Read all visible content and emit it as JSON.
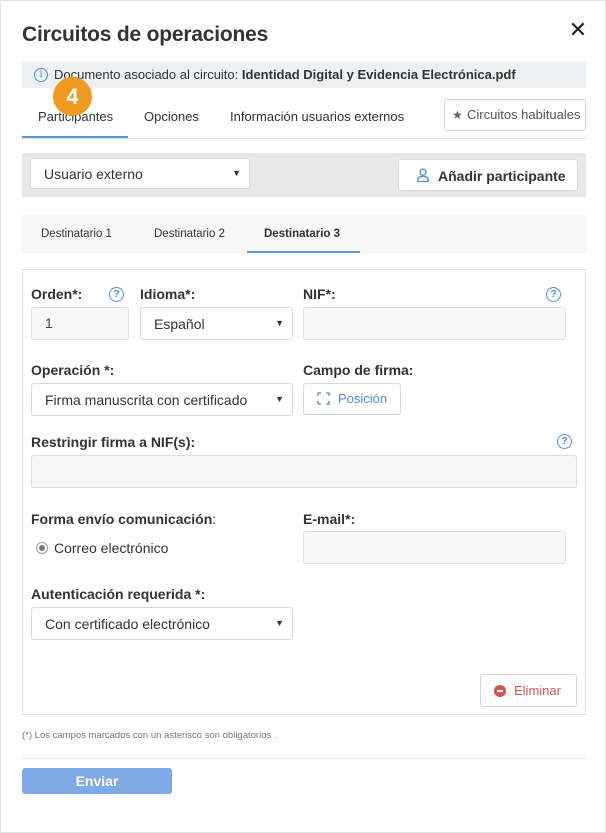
{
  "modal": {
    "title": "Circuitos de operaciones",
    "close_glyph": "✕"
  },
  "info": {
    "text": "Documento asociado al circuito:",
    "document": "Identidad Digital y Evidencia Electrónica.pdf"
  },
  "step_badge": "4",
  "top_tabs": [
    {
      "label": "Participantes",
      "active": true
    },
    {
      "label": "Opciones",
      "active": false
    },
    {
      "label": "Información usuarios externos",
      "active": false
    }
  ],
  "favorites_button": "Circuitos habituales",
  "participant_type": {
    "selected": "Usuario externo"
  },
  "add_participant_button": "Añadir participante",
  "recipient_tabs": [
    {
      "label": "Destinatario 1",
      "active": false
    },
    {
      "label": "Destinatario 2",
      "active": false
    },
    {
      "label": "Destinatario 3",
      "active": true
    }
  ],
  "form": {
    "order": {
      "label": "Orden*:",
      "value": "1"
    },
    "language": {
      "label": "Idioma*:",
      "selected": "Español"
    },
    "nif": {
      "label": "NIF*:",
      "value": ""
    },
    "operation": {
      "label": "Operación *:",
      "selected": "Firma manuscrita con certificado"
    },
    "signature_field": {
      "label": "Campo de firma:",
      "button": "Posición"
    },
    "restrict_nif": {
      "label": "Restringir firma a NIF(s):",
      "value": ""
    },
    "send_method": {
      "label": "Forma envío comunicación",
      "colon": ":",
      "option": "Correo electrónico"
    },
    "email": {
      "label": "E-mail*:",
      "value": ""
    },
    "auth": {
      "label": "Autenticación requerida *:",
      "selected": "Con certificado electrónico"
    },
    "delete_button": "Eliminar"
  },
  "footnote": "(*) Los campos marcados con un asterisco son obligatorios .",
  "send_button": "Enviar",
  "colors": {
    "accent_blue": "#4a8cd6",
    "tab_underline": "#5b9bd5",
    "badge_orange": "#f29a1f",
    "delete_red": "#d9534f",
    "send_button_bg": "#80a9e8"
  },
  "icons": {
    "info": "info-circle-icon",
    "help": "question-circle-icon",
    "star": "star-icon",
    "user_add": "user-icon",
    "position": "crop-frame-icon",
    "delete": "minus-circle-icon",
    "close": "close-icon",
    "dropdown": "triangle-down-icon"
  }
}
